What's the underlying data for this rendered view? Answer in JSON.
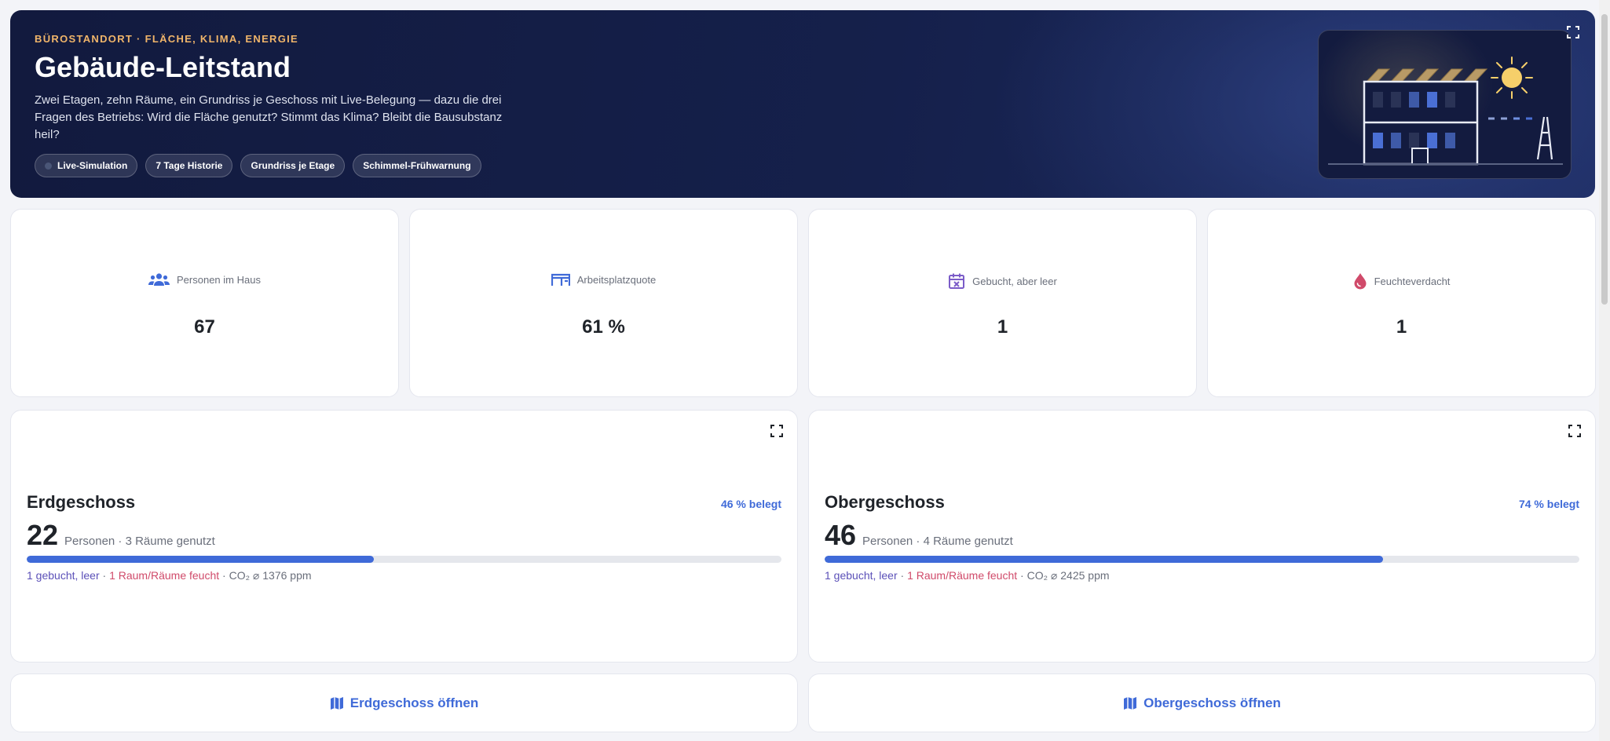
{
  "hero": {
    "kicker": "BÜROSTANDORT · FLÄCHE, KLIMA, ENERGIE",
    "title": "Gebäude-Leitstand",
    "description": "Zwei Etagen, zehn Räume, ein Grundriss je Geschoss mit Live-Belegung — dazu die drei Fragen des Betriebs: Wird die Fläche genutzt? Stimmt das Klima? Bleibt die Bausubstanz heil?",
    "chips": [
      "Live-Simulation",
      "7 Tage Historie",
      "Grundriss je Etage",
      "Schimmel-Frühwarnung"
    ]
  },
  "stats": [
    {
      "label": "Personen im Haus",
      "value": "67",
      "icon": "people-icon",
      "color": "#3f6ad8"
    },
    {
      "label": "Arbeitsplatzquote",
      "value": "61 %",
      "icon": "desk-icon",
      "color": "#3f6ad8"
    },
    {
      "label": "Gebucht, aber leer",
      "value": "1",
      "icon": "calendar-x-icon",
      "color": "#7b5cc8"
    },
    {
      "label": "Feuchteverdacht",
      "value": "1",
      "icon": "water-drop-icon",
      "color": "#d04a6a"
    }
  ],
  "floors": [
    {
      "name": "Erdgeschoss",
      "occupancy_label": "46 % belegt",
      "occupancy": 0.46,
      "people": "22",
      "people_text": "Personen · 3 Räume genutzt",
      "booked": "1 gebucht, leer",
      "wet": "1 Raum/Räume feucht",
      "co2": "CO₂ ⌀ 1376 ppm",
      "open_label": "Erdgeschoss öffnen"
    },
    {
      "name": "Obergeschoss",
      "occupancy_label": "74 % belegt",
      "occupancy": 0.74,
      "people": "46",
      "people_text": "Personen · 4 Räume genutzt",
      "booked": "1 gebucht, leer",
      "wet": "1 Raum/Räume feucht",
      "co2": "CO₂ ⌀ 2425 ppm",
      "open_label": "Obergeschoss öffnen"
    }
  ],
  "colors": {
    "accent": "#3f6ad8",
    "hero_bg": "#15204b",
    "kicker": "#f0b56a",
    "booked": "#5b50b8",
    "wet": "#d04a6a"
  }
}
